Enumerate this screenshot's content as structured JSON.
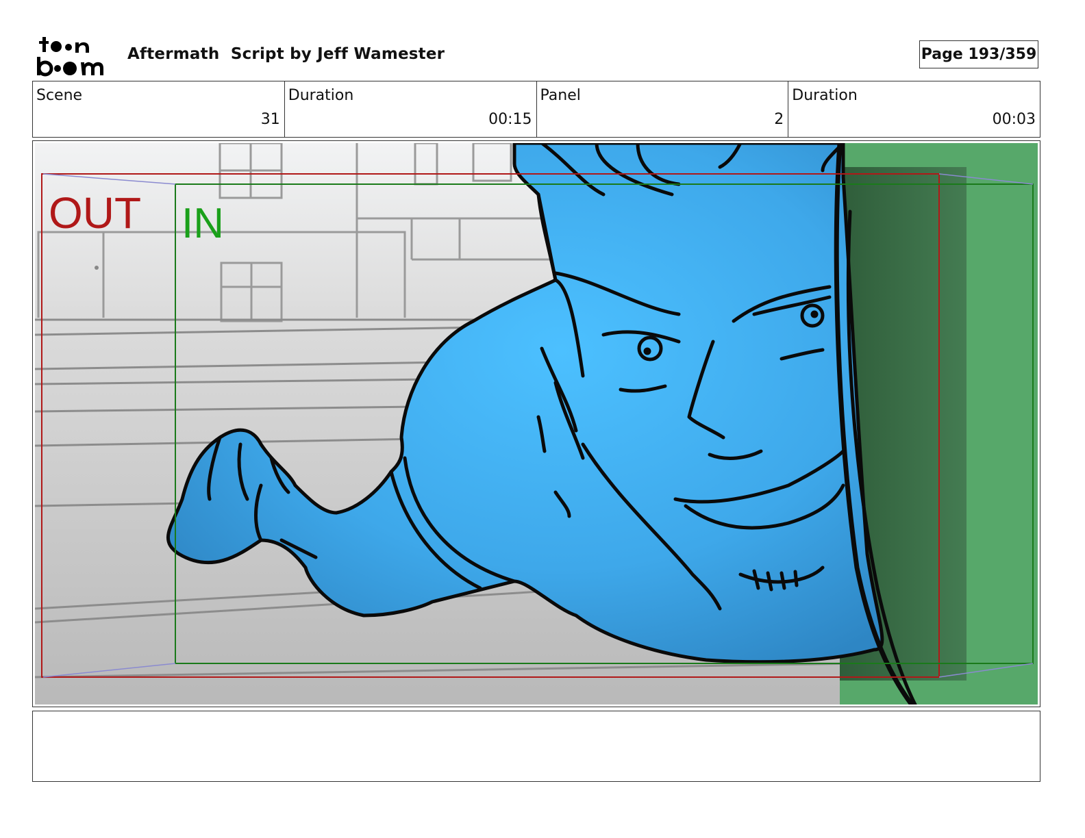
{
  "header": {
    "logo_text": "toon boom",
    "title": "Aftermath  Script by Jeff Wamester",
    "page": "Page 193/359"
  },
  "info": {
    "scene_label": "Scene",
    "scene_value": "31",
    "scene_duration_label": "Duration",
    "scene_duration_value": "00:15",
    "panel_label": "Panel",
    "panel_value": "2",
    "panel_duration_label": "Duration",
    "panel_duration_value": "00:03"
  },
  "panel": {
    "out_label": "OUT",
    "in_label": "IN",
    "colors": {
      "character_fill": "#45b8f8",
      "out_frame": "#b01818",
      "in_frame": "#1a7a1a",
      "green_screen": "#57a86a"
    }
  },
  "caption": {
    "text": ""
  }
}
